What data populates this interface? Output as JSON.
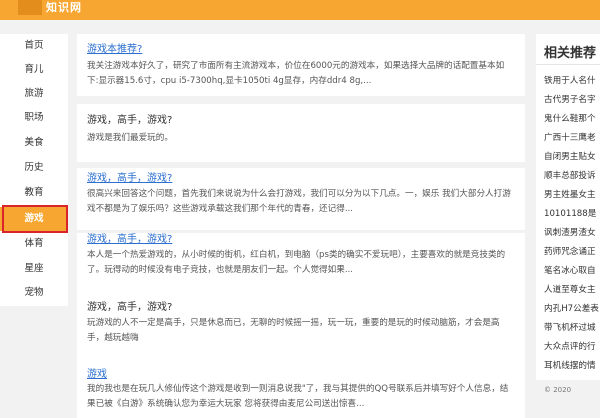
{
  "header": {
    "logo_text": "知识网"
  },
  "sidebar": {
    "items": [
      {
        "label": "首页"
      },
      {
        "label": "育儿"
      },
      {
        "label": "旅游"
      },
      {
        "label": "职场"
      },
      {
        "label": "美食"
      },
      {
        "label": "历史"
      },
      {
        "label": "教育"
      },
      {
        "label": "游戏",
        "active": true
      },
      {
        "label": "体育"
      },
      {
        "label": "星座"
      },
      {
        "label": "宠物"
      }
    ]
  },
  "feed": {
    "cards": [
      {
        "title": "游戏本推荐?",
        "is_link": true,
        "excerpt": "我关注游戏本好久了，研究了市面所有主流游戏本，价位在6000元的游戏本，如果选择大品牌的话配置基本如下:显示器15.6寸，cpu i5-7300hq,显卡1050ti 4g显存，内存ddr4 8g,..."
      },
      {
        "title": "游戏，高手，游戏?",
        "is_link": false,
        "excerpt": "游戏是我们最爱玩的。"
      },
      {
        "title": "游戏，高手，游戏?",
        "is_link": true,
        "excerpt": "很高兴来回答这个问题，首先我们来说说为什么会打游戏，我们可以分为以下几点。一，娱乐 我们大部分人打游戏不都是为了娱乐吗？这些游戏承载这我们那个年代的青春，还记得..."
      },
      {
        "title": "游戏，高手，游戏?",
        "is_link": true,
        "excerpt": "本人是一个热爱游戏的，从小时候的街机，红白机，到电脑（ps类的确实不爱玩吧），主要喜欢的就是竞技类的了。玩得动的时候没有电子竞技，也就是朋友们一起。个人觉得如果..."
      },
      {
        "title": "游戏，高手，游戏?",
        "is_link": false,
        "excerpt": "玩游戏的人不一定是高手，只是休息而已，无聊的时候摇一摇，玩一玩，重要的是玩的时候动脑筋，才会是高手，越玩越嗨"
      },
      {
        "title": "游戏",
        "is_link": true,
        "excerpt": "我的我也是在玩几人修仙传这个游戏是收到一则消息说我\"了，我与其提供的QQ号联系后并填写好个人信息，结果已被《白游》系统确认您为幸运大玩家 您将获得由麦尼公司送出惊喜..."
      }
    ]
  },
  "right": {
    "title": "相关推荐",
    "items": [
      {
        "label": "铁用于人名什"
      },
      {
        "label": "古代男子名字"
      },
      {
        "label": "鬼什么鞋那个"
      },
      {
        "label": "广西十三鹰老"
      },
      {
        "label": "自闭男主贴女"
      },
      {
        "label": "顺丰总部投诉"
      },
      {
        "label": "男主姓墨女主"
      },
      {
        "label": "10101188是"
      },
      {
        "label": "讽刺渣男渣女"
      },
      {
        "label": "药师咒念诵正"
      },
      {
        "label": "笔名冰心取自"
      },
      {
        "label": "人道至尊女主"
      },
      {
        "label": "内孔H7公差表"
      },
      {
        "label": "带飞机杯过城"
      },
      {
        "label": "大众点评的行"
      },
      {
        "label": "耳机线摆的情"
      }
    ],
    "footer": "© 2020"
  }
}
